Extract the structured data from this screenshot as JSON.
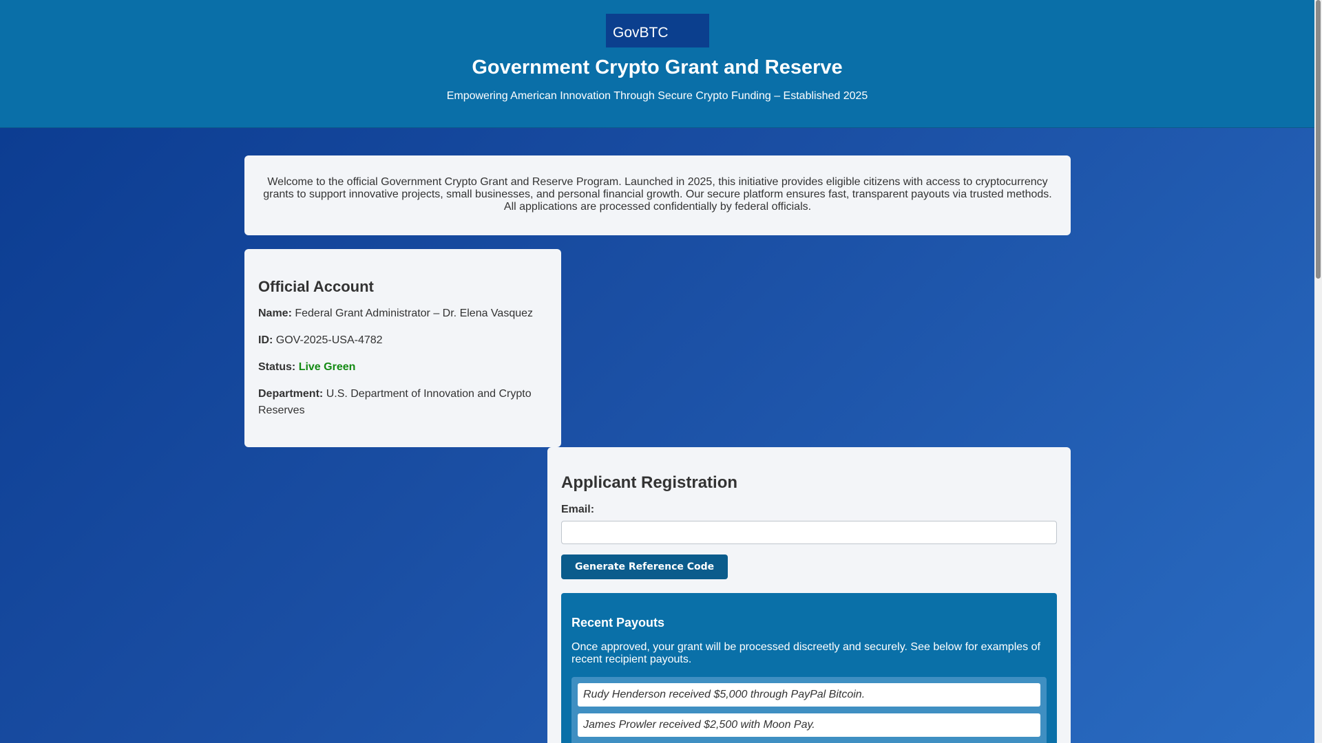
{
  "header": {
    "logo": "GovBTC",
    "title": "Government Crypto Grant and Reserve",
    "tagline": "Empowering American Innovation Through Secure Crypto Funding – Established 2025"
  },
  "welcome": {
    "text": "Welcome to the official Government Crypto Grant and Reserve Program. Launched in 2025, this initiative provides eligible citizens with access to cryptocurrency grants to support innovative projects, small businesses, and personal financial growth. Our secure platform ensures fast, transparent payouts via trusted methods. All applications are processed confidentially by federal officials."
  },
  "account": {
    "heading": "Official Account",
    "name_label": "Name:",
    "name_value": "Federal Grant Administrator – Dr. Elena Vasquez",
    "id_label": "ID:",
    "id_value": "GOV-2025-USA-4782",
    "status_label": "Status:",
    "status_value": "Live Green",
    "department_label": "Department:",
    "department_value": "U.S. Department of Innovation and Crypto Reserves"
  },
  "registration": {
    "heading": "Applicant Registration",
    "email_label": "Email:",
    "email_value": "",
    "button_label": "Generate Reference Code"
  },
  "payouts": {
    "heading": "Recent Payouts",
    "description": "Once approved, your grant will be processed discreetly and securely. See below for examples of recent recipient payouts.",
    "items": [
      "Rudy Henderson received $5,000 through PayPal Bitcoin.",
      "James Prowler received $2,500 with Moon Pay."
    ]
  },
  "colors": {
    "header_bg": "#0a6fa8",
    "logo_bg": "#0b3f8e",
    "button_bg": "#0b5c8c",
    "status_green": "#138a13"
  }
}
